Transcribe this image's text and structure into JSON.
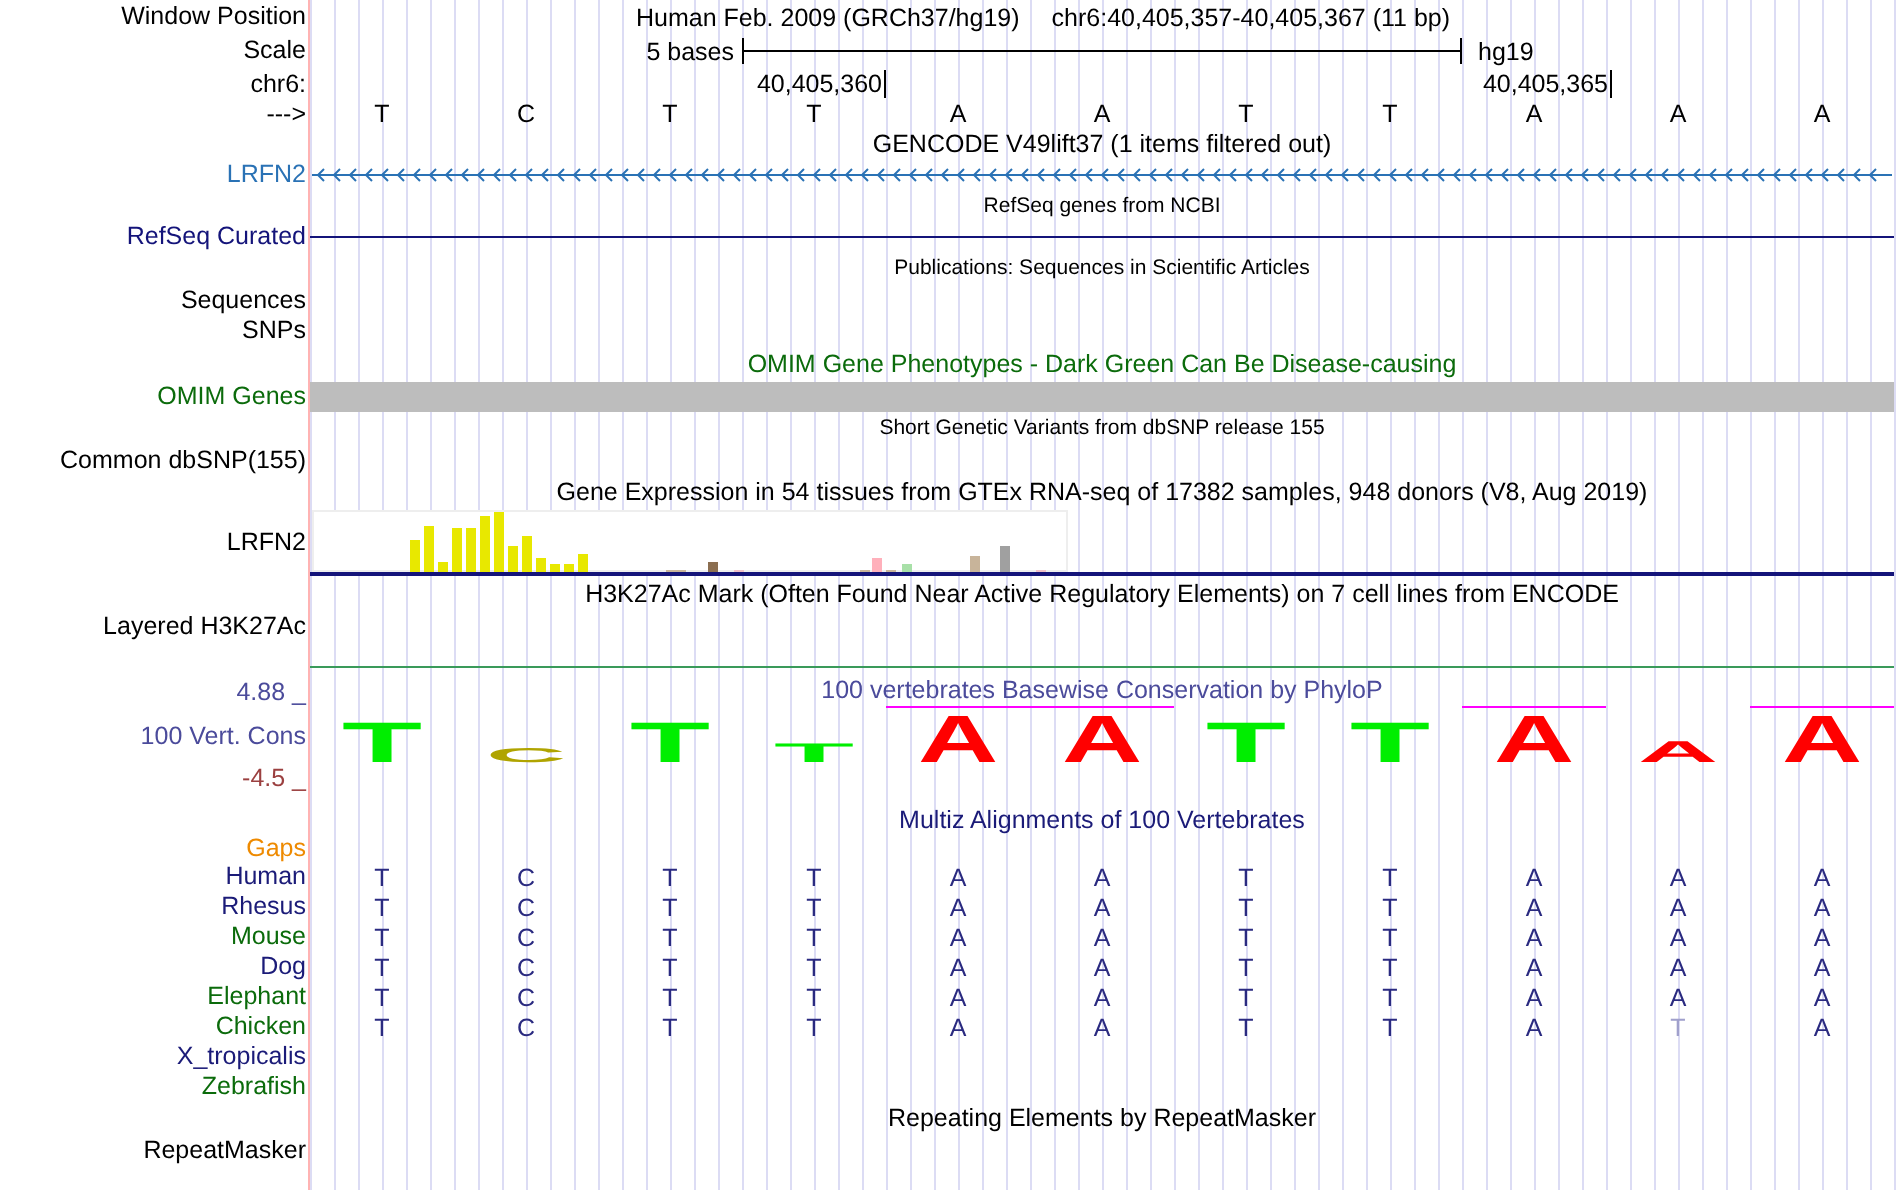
{
  "header": {
    "position_label": "Window Position",
    "assembly": "Human Feb. 2009 (GRCh37/hg19)",
    "position": "chr6:40,405,357-40,405,367 (11 bp)",
    "scale_label": "Scale",
    "scale_text": "5 bases",
    "scale_db": "hg19",
    "chrom_label": "chr6:",
    "ticks": [
      "40,405,360",
      "40,405,365"
    ],
    "strand_label": "--->",
    "bases": [
      "T",
      "C",
      "T",
      "T",
      "A",
      "A",
      "T",
      "T",
      "A",
      "A",
      "A"
    ]
  },
  "tracks": [
    {
      "kind": "gene",
      "title": "GENCODE V49lift37 (1 items filtered out)",
      "small_title": false,
      "labels": [
        "LRFN2"
      ],
      "color": "#2a72b5"
    },
    {
      "kind": "line",
      "title": "RefSeq genes from NCBI",
      "small_title": true,
      "labels": [
        "RefSeq Curated"
      ],
      "color": "#14147a"
    },
    {
      "kind": "empty",
      "title": "Publications: Sequences in Scientific Articles",
      "small_title": true,
      "labels": [
        "Sequences",
        "SNPs"
      ],
      "color": "#000000"
    },
    {
      "kind": "bar",
      "title": "OMIM Gene Phenotypes - Dark Green Can Be Disease-causing",
      "small_title": false,
      "labels": [
        "OMIM Genes"
      ],
      "color": "#0b6b0b"
    },
    {
      "kind": "empty",
      "title": "Short Genetic Variants from dbSNP release 155",
      "small_title": true,
      "labels": [
        "Common dbSNP(155)"
      ],
      "color": "#000000"
    },
    {
      "kind": "expression",
      "title": "Gene Expression in 54 tissues from GTEx RNA-seq of 17382 samples, 948 donors (V8, Aug 2019)",
      "small_title": false,
      "labels": [
        "LRFN2"
      ],
      "color": "#000000"
    },
    {
      "kind": "layered",
      "title": "H3K27Ac Mark (Often Found Near Active Regulatory Elements) on 7 cell lines from ENCODE",
      "small_title": false,
      "labels": [
        "Layered H3K27Ac"
      ],
      "color": "#000000"
    },
    {
      "kind": "conservation",
      "title": "100 vertebrates Basewise Conservation by PhyloP",
      "small_title": false,
      "labels": [
        "100 Vert. Cons"
      ],
      "color": "#4b4b9b",
      "axis_max": "4.88 _",
      "axis_min": "-4.5 _",
      "logo": [
        {
          "base": "T",
          "conserved": false
        },
        {
          "base": "C",
          "conserved": false
        },
        {
          "base": "T",
          "conserved": false
        },
        {
          "base": "T",
          "conserved": false
        },
        {
          "base": "A",
          "conserved": true
        },
        {
          "base": "A",
          "conserved": true
        },
        {
          "base": "T",
          "conserved": false
        },
        {
          "base": "T",
          "conserved": false
        },
        {
          "base": "A",
          "conserved": true
        },
        {
          "base": "A",
          "conserved": false
        },
        {
          "base": "A",
          "conserved": true
        }
      ]
    },
    {
      "kind": "multiz",
      "title": "Multiz Alignments of 100 Vertebrates",
      "small_title": false,
      "labels": [
        "Gaps"
      ],
      "color": "#ee8a00",
      "species": [
        {
          "name": "Human",
          "color": "#1b1b78",
          "bases": [
            {
              "base": "T",
              "faded": false
            },
            {
              "base": "C",
              "faded": false
            },
            {
              "base": "T",
              "faded": false
            },
            {
              "base": "T",
              "faded": false
            },
            {
              "base": "A",
              "faded": false
            },
            {
              "base": "A",
              "faded": false
            },
            {
              "base": "T",
              "faded": false
            },
            {
              "base": "T",
              "faded": false
            },
            {
              "base": "A",
              "faded": false
            },
            {
              "base": "A",
              "faded": false
            },
            {
              "base": "A",
              "faded": false
            }
          ]
        },
        {
          "name": "Rhesus",
          "color": "#1b1b78",
          "bases": [
            {
              "base": "T",
              "faded": false
            },
            {
              "base": "C",
              "faded": false
            },
            {
              "base": "T",
              "faded": false
            },
            {
              "base": "T",
              "faded": false
            },
            {
              "base": "A",
              "faded": false
            },
            {
              "base": "A",
              "faded": false
            },
            {
              "base": "T",
              "faded": false
            },
            {
              "base": "T",
              "faded": false
            },
            {
              "base": "A",
              "faded": false
            },
            {
              "base": "A",
              "faded": false
            },
            {
              "base": "A",
              "faded": false
            }
          ]
        },
        {
          "name": "Mouse",
          "color": "#0b6b0b",
          "bases": [
            {
              "base": "T",
              "faded": false
            },
            {
              "base": "C",
              "faded": false
            },
            {
              "base": "T",
              "faded": false
            },
            {
              "base": "T",
              "faded": false
            },
            {
              "base": "A",
              "faded": false
            },
            {
              "base": "A",
              "faded": false
            },
            {
              "base": "T",
              "faded": false
            },
            {
              "base": "T",
              "faded": false
            },
            {
              "base": "A",
              "faded": false
            },
            {
              "base": "A",
              "faded": false
            },
            {
              "base": "A",
              "faded": false
            }
          ]
        },
        {
          "name": "Dog",
          "color": "#1b1b78",
          "bases": [
            {
              "base": "T",
              "faded": false
            },
            {
              "base": "C",
              "faded": false
            },
            {
              "base": "T",
              "faded": false
            },
            {
              "base": "T",
              "faded": false
            },
            {
              "base": "A",
              "faded": false
            },
            {
              "base": "A",
              "faded": false
            },
            {
              "base": "T",
              "faded": false
            },
            {
              "base": "T",
              "faded": false
            },
            {
              "base": "A",
              "faded": false
            },
            {
              "base": "A",
              "faded": false
            },
            {
              "base": "A",
              "faded": false
            }
          ]
        },
        {
          "name": "Elephant",
          "color": "#0b6b0b",
          "bases": [
            {
              "base": "T",
              "faded": false
            },
            {
              "base": "C",
              "faded": false
            },
            {
              "base": "T",
              "faded": false
            },
            {
              "base": "T",
              "faded": false
            },
            {
              "base": "A",
              "faded": false
            },
            {
              "base": "A",
              "faded": false
            },
            {
              "base": "T",
              "faded": false
            },
            {
              "base": "T",
              "faded": false
            },
            {
              "base": "A",
              "faded": false
            },
            {
              "base": "A",
              "faded": false
            },
            {
              "base": "A",
              "faded": false
            }
          ]
        },
        {
          "name": "Chicken",
          "color": "#0b6b0b",
          "bases": [
            {
              "base": "T",
              "faded": false
            },
            {
              "base": "C",
              "faded": false
            },
            {
              "base": "T",
              "faded": false
            },
            {
              "base": "T",
              "faded": false
            },
            {
              "base": "A",
              "faded": false
            },
            {
              "base": "A",
              "faded": false
            },
            {
              "base": "T",
              "faded": false
            },
            {
              "base": "T",
              "faded": false
            },
            {
              "base": "A",
              "faded": false
            },
            {
              "base": "T",
              "faded": true
            },
            {
              "base": "A",
              "faded": false
            }
          ]
        },
        {
          "name": "X_tropicalis",
          "color": "#1b1b78"
        },
        {
          "name": "Zebrafish",
          "color": "#0b6b0b"
        }
      ]
    },
    {
      "kind": "empty",
      "title": "Repeating Elements by RepeatMasker",
      "small_title": false,
      "labels": [
        "RepeatMasker"
      ],
      "color": "#000000"
    }
  ]
}
